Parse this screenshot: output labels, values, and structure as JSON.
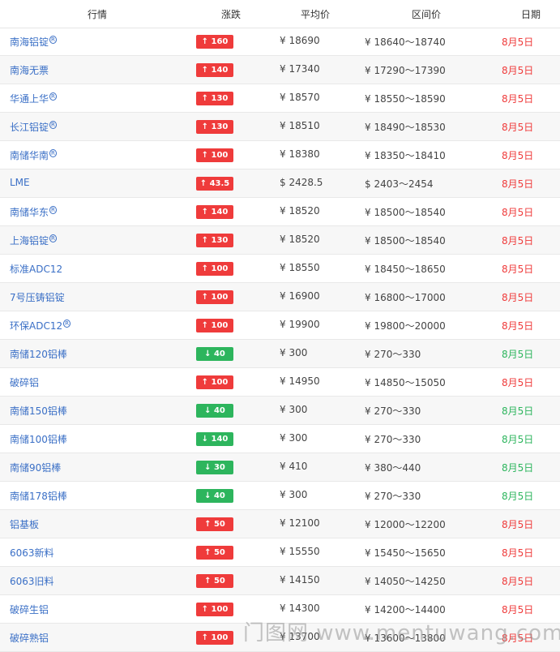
{
  "header": {
    "name": "行情",
    "change": "涨跌",
    "avg": "平均价",
    "range": "区间价",
    "date": "日期"
  },
  "colors": {
    "up": "#ef3b3b",
    "down": "#2db55d",
    "link": "#3a6fc6"
  },
  "rows": [
    {
      "name": "南海铝锭",
      "mark": true,
      "dir": "up",
      "change": "↑ 160",
      "avg": "¥ 18690",
      "range": "¥ 18640～18740",
      "date": "8月5日"
    },
    {
      "name": "南海无票",
      "mark": false,
      "dir": "up",
      "change": "↑ 140",
      "avg": "¥ 17340",
      "range": "¥ 17290～17390",
      "date": "8月5日"
    },
    {
      "name": "华通上华",
      "mark": true,
      "dir": "up",
      "change": "↑ 130",
      "avg": "¥ 18570",
      "range": "¥ 18550～18590",
      "date": "8月5日"
    },
    {
      "name": "长江铝锭",
      "mark": true,
      "dir": "up",
      "change": "↑ 130",
      "avg": "¥ 18510",
      "range": "¥ 18490～18530",
      "date": "8月5日"
    },
    {
      "name": "南储华南",
      "mark": true,
      "dir": "up",
      "change": "↑ 100",
      "avg": "¥ 18380",
      "range": "¥ 18350～18410",
      "date": "8月5日"
    },
    {
      "name": "LME",
      "mark": false,
      "dir": "up",
      "change": "↑ 43.5",
      "avg": "$ 2428.5",
      "range": "$ 2403～2454",
      "date": "8月5日"
    },
    {
      "name": "南储华东",
      "mark": true,
      "dir": "up",
      "change": "↑ 140",
      "avg": "¥ 18520",
      "range": "¥ 18500～18540",
      "date": "8月5日"
    },
    {
      "name": "上海铝锭",
      "mark": true,
      "dir": "up",
      "change": "↑ 130",
      "avg": "¥ 18520",
      "range": "¥ 18500～18540",
      "date": "8月5日"
    },
    {
      "name": "标准ADC12",
      "mark": false,
      "dir": "up",
      "change": "↑ 100",
      "avg": "¥ 18550",
      "range": "¥ 18450～18650",
      "date": "8月5日"
    },
    {
      "name": "7号压铸铝锭",
      "mark": false,
      "dir": "up",
      "change": "↑ 100",
      "avg": "¥ 16900",
      "range": "¥ 16800～17000",
      "date": "8月5日"
    },
    {
      "name": "环保ADC12",
      "mark": true,
      "dir": "up",
      "change": "↑ 100",
      "avg": "¥ 19900",
      "range": "¥ 19800～20000",
      "date": "8月5日"
    },
    {
      "name": "南储120铝棒",
      "mark": false,
      "dir": "down",
      "change": "↓ 40",
      "avg": "¥ 300",
      "range": "¥ 270～330",
      "date": "8月5日"
    },
    {
      "name": "破碎铝",
      "mark": false,
      "dir": "up",
      "change": "↑ 100",
      "avg": "¥ 14950",
      "range": "¥ 14850～15050",
      "date": "8月5日"
    },
    {
      "name": "南储150铝棒",
      "mark": false,
      "dir": "down",
      "change": "↓ 40",
      "avg": "¥ 300",
      "range": "¥ 270～330",
      "date": "8月5日"
    },
    {
      "name": "南储100铝棒",
      "mark": false,
      "dir": "down",
      "change": "↓ 140",
      "avg": "¥ 300",
      "range": "¥ 270～330",
      "date": "8月5日"
    },
    {
      "name": "南储90铝棒",
      "mark": false,
      "dir": "down",
      "change": "↓ 30",
      "avg": "¥ 410",
      "range": "¥ 380～440",
      "date": "8月5日"
    },
    {
      "name": "南储178铝棒",
      "mark": false,
      "dir": "down",
      "change": "↓ 40",
      "avg": "¥ 300",
      "range": "¥ 270～330",
      "date": "8月5日"
    },
    {
      "name": "铝基板",
      "mark": false,
      "dir": "up",
      "change": "↑ 50",
      "avg": "¥ 12100",
      "range": "¥ 12000～12200",
      "date": "8月5日"
    },
    {
      "name": "6063新料",
      "mark": false,
      "dir": "up",
      "change": "↑ 50",
      "avg": "¥ 15550",
      "range": "¥ 15450～15650",
      "date": "8月5日"
    },
    {
      "name": "6063旧料",
      "mark": false,
      "dir": "up",
      "change": "↑ 50",
      "avg": "¥ 14150",
      "range": "¥ 14050～14250",
      "date": "8月5日"
    },
    {
      "name": "破碎生铝",
      "mark": false,
      "dir": "up",
      "change": "↑ 100",
      "avg": "¥ 14300",
      "range": "¥ 14200～14400",
      "date": "8月5日"
    },
    {
      "name": "破碎熟铝",
      "mark": false,
      "dir": "up",
      "change": "↑ 100",
      "avg": "¥ 13700",
      "range": "¥ 13600～13800",
      "date": "8月5日"
    }
  ],
  "watermark": "门图网 www.mentuwang.com"
}
